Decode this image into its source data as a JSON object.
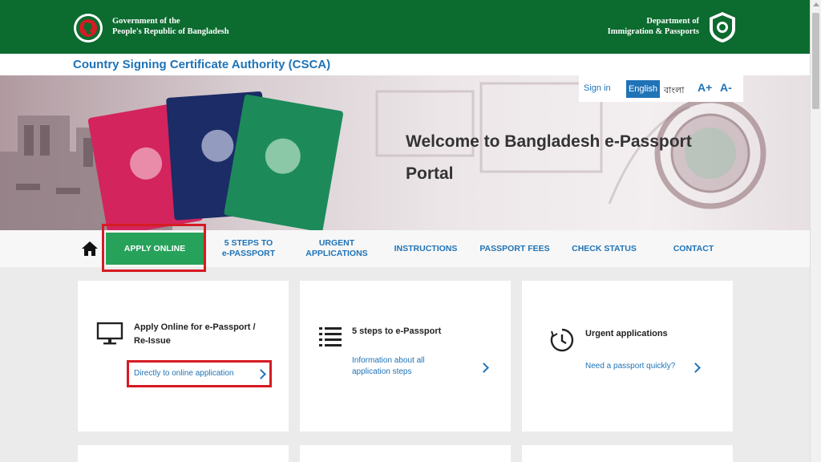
{
  "header": {
    "gov_line1": "Government of the",
    "gov_line2": "People's Republic of Bangladesh",
    "dept_line1": "Department of",
    "dept_line2": "Immigration & Passports",
    "gov_emblem_icon": "bangladesh-emblem-icon",
    "dept_emblem_icon": "passport-department-emblem-icon"
  },
  "csca": {
    "title": "Country Signing Certificate Authority (CSCA)"
  },
  "hero": {
    "title": "Welcome to Bangladesh e-Passport Portal",
    "sign_in": "Sign in",
    "lang_english": "English",
    "lang_bangla": "বাংলা",
    "font_increase": "A+",
    "font_decrease": "A-"
  },
  "nav": {
    "home_icon": "home-icon",
    "apply_online": "APPLY ONLINE",
    "steps_line1": "5 STEPS TO",
    "steps_line2": "e-PASSPORT",
    "urgent_line1": "URGENT",
    "urgent_line2": "APPLICATIONS",
    "instructions": "INSTRUCTIONS",
    "fees": "PASSPORT FEES",
    "status": "CHECK STATUS",
    "contact": "CONTACT"
  },
  "cards": [
    {
      "icon": "monitor-icon",
      "title_line1": "Apply Online for e-Passport /",
      "title_line2": "Re-Issue",
      "link": "Directly to online application"
    },
    {
      "icon": "list-icon",
      "title": "5 steps to e-Passport",
      "link_line1": "Information about all",
      "link_line2": "application steps"
    },
    {
      "icon": "clock-icon",
      "title": "Urgent applications",
      "link": "Need a passport quickly?"
    }
  ],
  "colors": {
    "header_green": "#0c6b2f",
    "link_blue": "#1f73b7",
    "apply_green": "#27a25a",
    "highlight_red": "#d61b23"
  }
}
